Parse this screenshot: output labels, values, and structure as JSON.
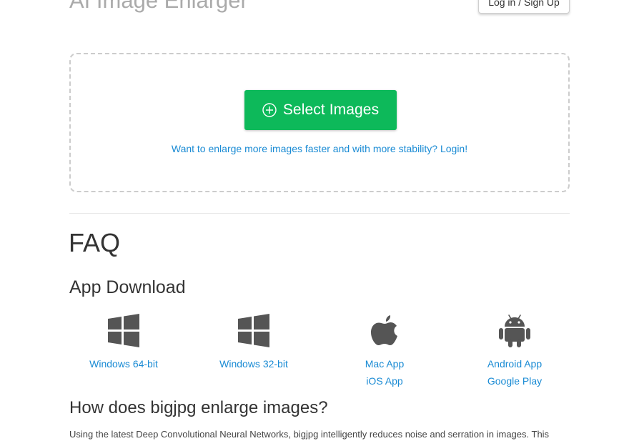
{
  "header": {
    "title": "AI Image Enlarger",
    "login_label": "Log in / Sign Up"
  },
  "upload": {
    "select_label": "Select Images",
    "login_hint": "Want to enlarge more images faster and with more stability? Login!"
  },
  "faq": {
    "title": "FAQ"
  },
  "app_download": {
    "title": "App Download",
    "items": [
      {
        "icon": "windows-icon",
        "links": [
          "Windows 64-bit"
        ]
      },
      {
        "icon": "windows-icon",
        "links": [
          "Windows 32-bit"
        ]
      },
      {
        "icon": "apple-icon",
        "links": [
          "Mac App",
          "iOS App"
        ]
      },
      {
        "icon": "android-icon",
        "links": [
          "Android App",
          "Google Play"
        ]
      }
    ]
  },
  "how": {
    "title": "How does bigjpg enlarge images?",
    "text": "Using the latest Deep Convolutional Neural Networks, bigjpg intelligently reduces noise and serration in images. This"
  },
  "colors": {
    "accent_green": "#0db95a",
    "link_blue": "#1a8bd4",
    "icon_gray": "#555555"
  }
}
